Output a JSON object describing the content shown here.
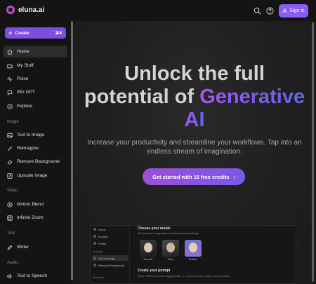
{
  "app": {
    "logo_text": "eluna.ai",
    "accent": "#8b5cf6"
  },
  "header": {
    "signin_label": "Sign in",
    "icons": [
      "search-icon",
      "help-icon",
      "user-icon"
    ]
  },
  "sidebar": {
    "create_label": "Create",
    "create_shortcut": "⌘K",
    "items": [
      {
        "label": "Home",
        "icon": "home-icon",
        "active": true
      },
      {
        "label": "My Stuff",
        "icon": "folder-icon"
      },
      {
        "label": "Pulse",
        "icon": "pulse-icon"
      },
      {
        "label": "Wiz GPT",
        "icon": "chat-icon"
      },
      {
        "label": "Explore",
        "icon": "compass-icon"
      }
    ],
    "sections": [
      {
        "label": "Image",
        "items": [
          {
            "label": "Text to Image",
            "icon": "image-icon"
          },
          {
            "label": "Reimagine",
            "icon": "wand-icon"
          },
          {
            "label": "Remove Background",
            "icon": "eraser-icon"
          },
          {
            "label": "Upscale Image",
            "icon": "upscale-icon"
          }
        ]
      },
      {
        "label": "Video",
        "items": [
          {
            "label": "Motion Blend",
            "icon": "motion-icon"
          },
          {
            "label": "Infinite Zoom",
            "icon": "zoom-icon"
          }
        ]
      },
      {
        "label": "Text",
        "items": [
          {
            "label": "Writer",
            "icon": "pen-icon"
          }
        ]
      },
      {
        "label": "Audio",
        "items": [
          {
            "label": "Text to Speech",
            "icon": "speaker-icon"
          }
        ]
      }
    ]
  },
  "hero": {
    "line1": "Unlock the full",
    "line2_plain": "potential of",
    "line2_grad": "Generative",
    "line3_grad": "AI",
    "subtitle": "Increase your productivity and streamline your workflows. Tap into an endless stream of imagination.",
    "cta_label": "Get started with 15 free credits"
  },
  "preview": {
    "side_items": [
      "Home",
      "Explore",
      "Profile"
    ],
    "products_label": "Products",
    "product_items": [
      "Text to Image",
      "Remove Background"
    ],
    "resources_label": "Resources",
    "choose_title": "Choose your model",
    "choose_text": "We'll adapt the image options (in the advanced settings)",
    "models": [
      "Eluna AI",
      "Pixel",
      "Realism"
    ],
    "prompt_title": "Create your prompt",
    "prompt_text": "Press  SPACE  to create a tag and click  ✕  to set the priority. Drag & drop to reorder."
  }
}
